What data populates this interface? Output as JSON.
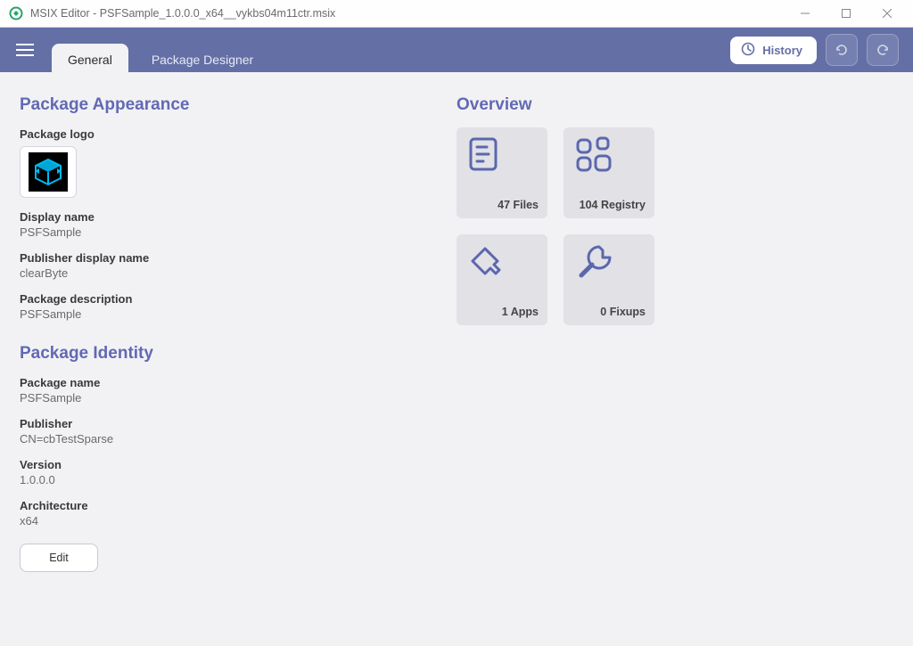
{
  "window": {
    "title": "MSIX Editor - PSFSample_1.0.0.0_x64__vykbs04m11ctr.msix"
  },
  "ribbon": {
    "tabs": [
      {
        "label": "General"
      },
      {
        "label": "Package Designer"
      }
    ],
    "history_label": "History"
  },
  "sections": {
    "appearance_heading": "Package Appearance",
    "identity_heading": "Package Identity",
    "overview_heading": "Overview"
  },
  "appearance": {
    "logo_label": "Package logo",
    "display_name_label": "Display name",
    "display_name_value": "PSFSample",
    "publisher_display_name_label": "Publisher display name",
    "publisher_display_name_value": "clearByte",
    "description_label": "Package description",
    "description_value": "PSFSample"
  },
  "identity": {
    "package_name_label": "Package name",
    "package_name_value": "PSFSample",
    "publisher_label": "Publisher",
    "publisher_value": "CN=cbTestSparse",
    "version_label": "Version",
    "version_value": "1.0.0.0",
    "architecture_label": "Architecture",
    "architecture_value": "x64",
    "edit_button": "Edit"
  },
  "overview": {
    "files_count": "47 Files",
    "registry_count": "104 Registry",
    "apps_count": "1 Apps",
    "fixups_count": "0 Fixups"
  }
}
